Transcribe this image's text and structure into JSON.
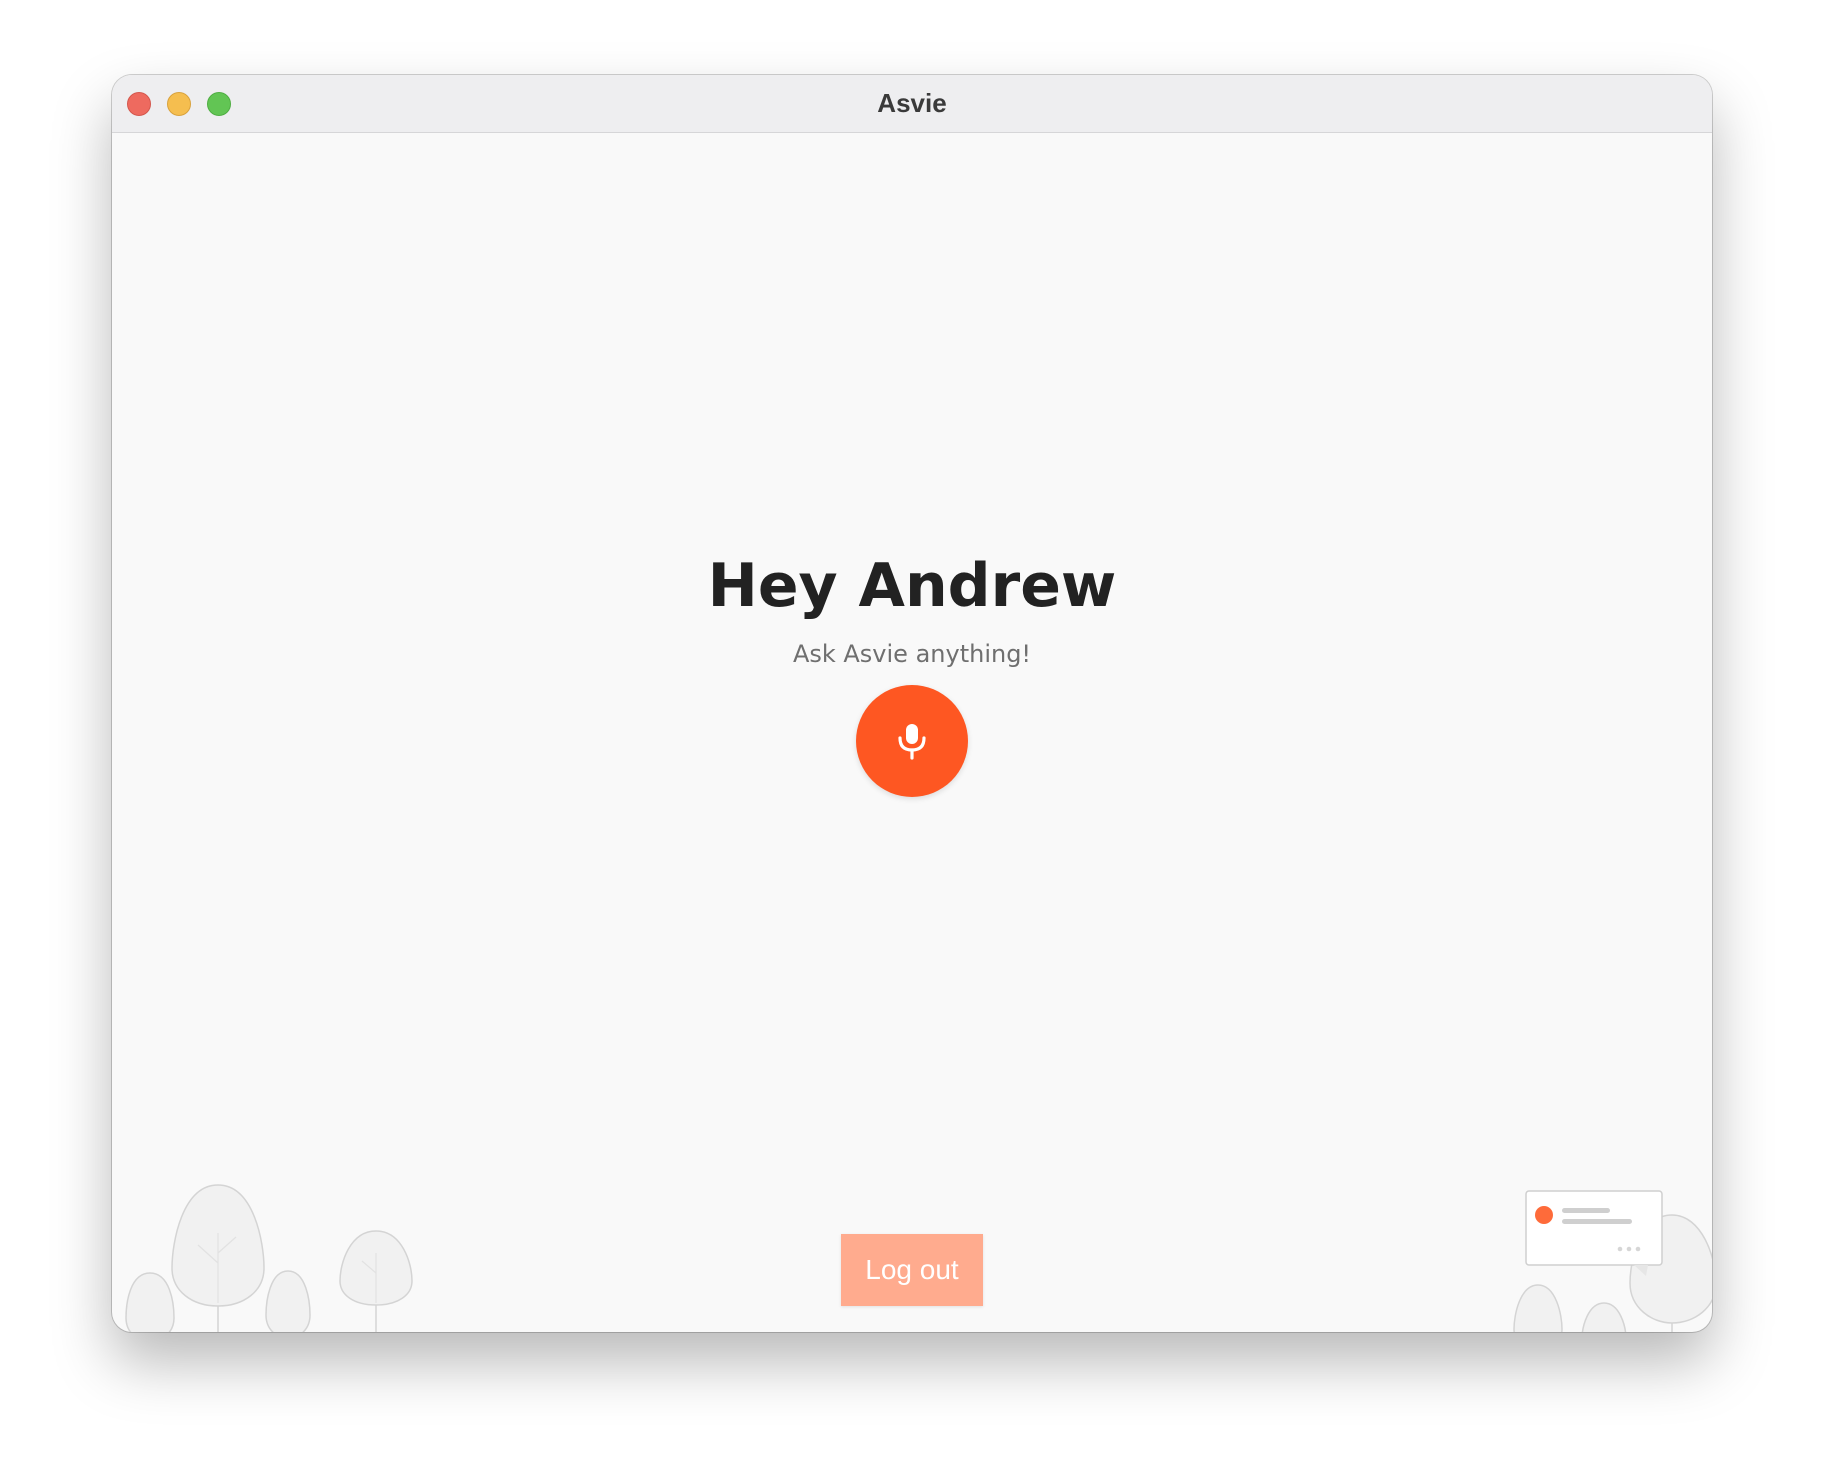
{
  "window": {
    "title": "Asvie"
  },
  "main": {
    "greeting": "Hey Andrew",
    "subtitle": "Ask Asvie anything!",
    "mic_icon": "microphone-icon"
  },
  "footer": {
    "logout_label": "Log out"
  },
  "colors": {
    "accent": "#fe5722",
    "logout_bg": "#ffab8e",
    "background": "#f9f9f9",
    "close": "#ee6a5f",
    "minimize": "#f5be4f",
    "maximize": "#62c554"
  }
}
